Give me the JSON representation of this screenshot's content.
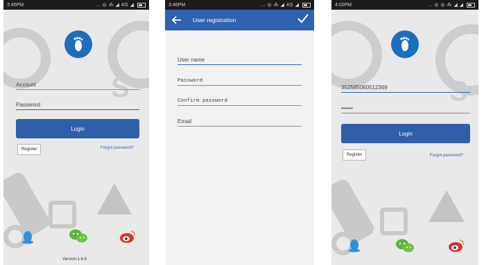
{
  "screens": [
    {
      "statusbar": {
        "time": "3:45PM",
        "signal": "... ◎ ⁂ ◢ 4G ◢"
      },
      "login": {
        "account_placeholder": "Account",
        "password_placeholder": "Password",
        "login_label": "Login",
        "register_label": "Register",
        "forgot_label": "Forgot password?"
      },
      "version": "Version:1.6.6"
    },
    {
      "statusbar": {
        "time": "3:46PM",
        "signal": "... ◎ ⁂ ◢ 4G ◢"
      },
      "appbar": {
        "title": "User registration"
      },
      "fields": [
        "User name",
        "Password",
        "Confirm password",
        "Email"
      ]
    },
    {
      "statusbar": {
        "time": "4:02PM",
        "signal": "... ◎ ◎ ⁂ ◢ ◢"
      },
      "login": {
        "account_value": "352585060512369",
        "password_value": "••••••",
        "login_label": "Login",
        "register_label": "Register",
        "forgot_label": "Forgot password?"
      }
    }
  ],
  "colors": {
    "primary": "#2e5fa8",
    "logo": "#1d6ebd",
    "qq": "#2f8fe0",
    "wechat": "#5fb33f",
    "weibo": "#d9312b"
  },
  "icons": [
    "foot-logo-icon",
    "back-arrow-icon",
    "check-icon",
    "qq-icon",
    "wechat-icon",
    "weibo-icon"
  ]
}
